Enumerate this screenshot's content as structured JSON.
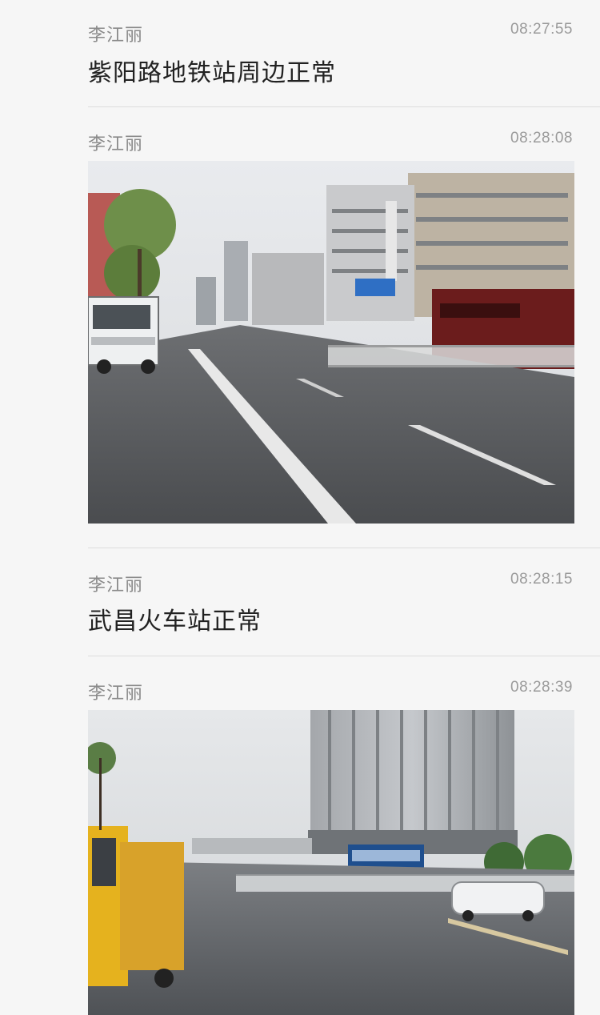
{
  "messages": [
    {
      "sender": "李江丽",
      "time": "08:27:55",
      "text": "紫阳路地铁站周边正常"
    },
    {
      "sender": "李江丽",
      "time": "08:28:08",
      "image": "rainy-street-photo-1"
    },
    {
      "sender": "李江丽",
      "time": "08:28:15",
      "text": "武昌火车站正常"
    },
    {
      "sender": "李江丽",
      "time": "08:28:39",
      "image": "rainy-street-photo-2"
    }
  ],
  "colors": {
    "background": "#f6f6f6",
    "sender": "#8a8a8a",
    "time": "#9a9a9a",
    "message_text": "#222222",
    "divider": "#dcdcdc"
  }
}
